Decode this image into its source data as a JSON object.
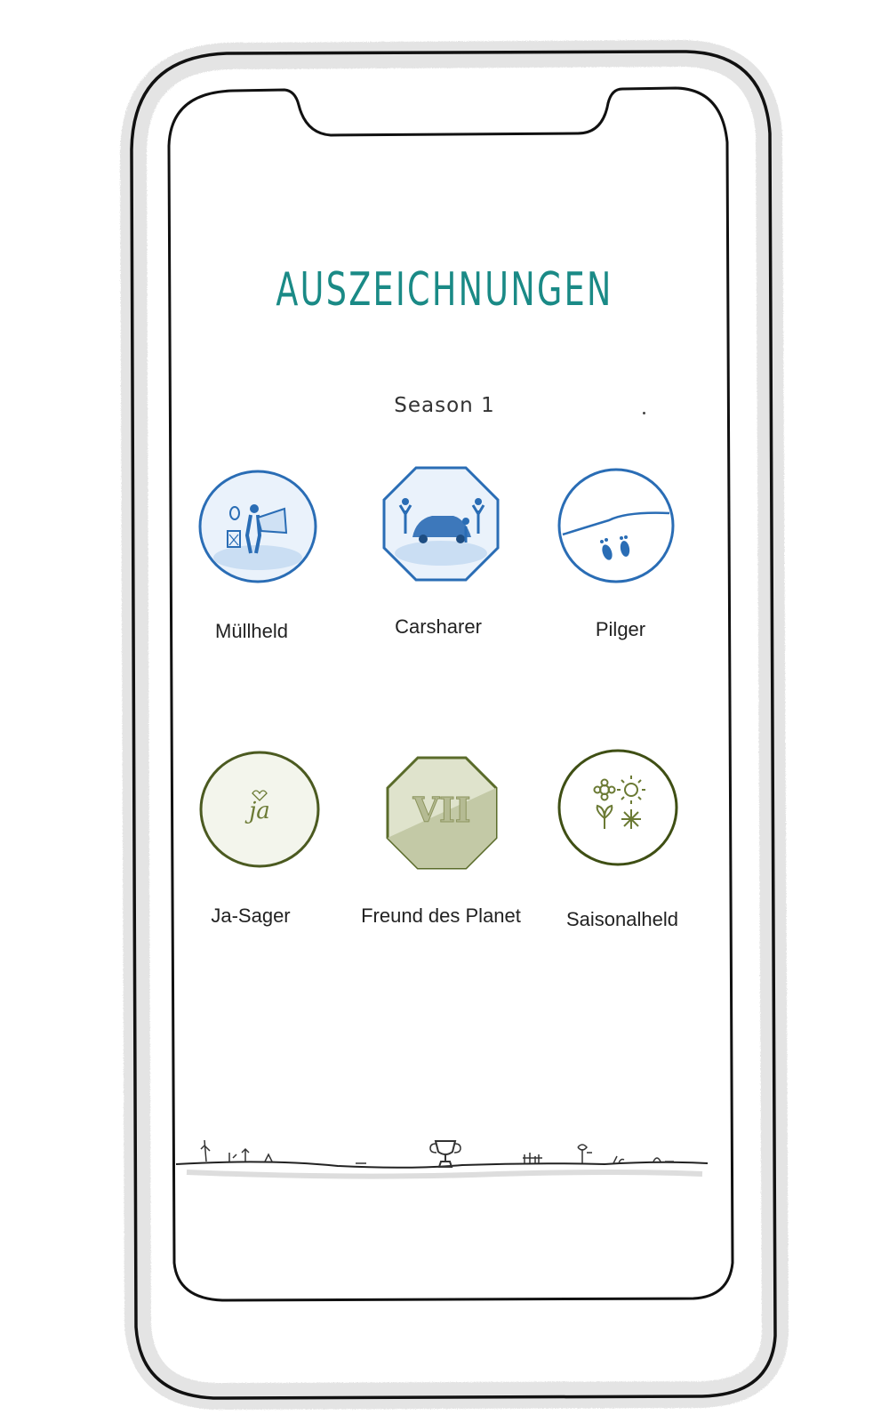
{
  "header": {
    "title": "AUSZEICHNUNGEN",
    "season": "Season 1"
  },
  "badges": [
    {
      "label": "Müllheld",
      "color": "#2a6db5",
      "icon": "trash-hero-icon"
    },
    {
      "label": "Carsharer",
      "color": "#2a6db5",
      "icon": "carshare-icon"
    },
    {
      "label": "Pilger",
      "color": "#2a6db5",
      "icon": "footprints-icon"
    },
    {
      "label": "Ja-Sager",
      "color": "#5a6b2a",
      "icon": "ja-text-icon"
    },
    {
      "label": "Freund des Planet",
      "color": "#5a6b2a",
      "icon": "roman-seven-icon"
    },
    {
      "label": "Saisonalheld",
      "color": "#4f5f1f",
      "icon": "seasons-icon"
    }
  ],
  "colors": {
    "title": "#1a8a86",
    "blue_badge": "#2a6db5",
    "green_badge": "#5a6b2a"
  }
}
